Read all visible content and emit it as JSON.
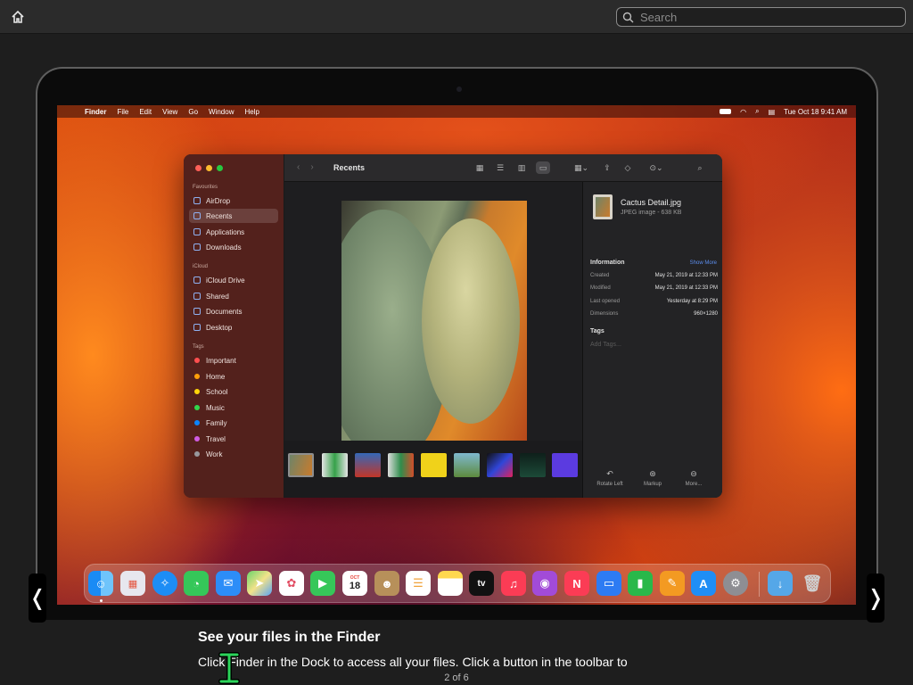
{
  "search": {
    "placeholder": "Search"
  },
  "menubar": {
    "app": "Finder",
    "items": [
      "File",
      "Edit",
      "View",
      "Go",
      "Window",
      "Help"
    ],
    "datetime": "Tue Oct 18  9:41 AM"
  },
  "finder": {
    "title": "Recents",
    "sidebar": {
      "favourites_label": "Favourites",
      "favourites": [
        "AirDrop",
        "Recents",
        "Applications",
        "Downloads"
      ],
      "icloud_label": "iCloud",
      "icloud": [
        "iCloud Drive",
        "Shared",
        "Documents",
        "Desktop"
      ],
      "tags_label": "Tags",
      "tags": [
        {
          "name": "Important",
          "color": "#ff4f4f"
        },
        {
          "name": "Home",
          "color": "#ff9f0a"
        },
        {
          "name": "School",
          "color": "#ffd60a"
        },
        {
          "name": "Music",
          "color": "#32d74b"
        },
        {
          "name": "Family",
          "color": "#0a84ff"
        },
        {
          "name": "Travel",
          "color": "#d05ce3"
        },
        {
          "name": "Work",
          "color": "#98989d"
        }
      ]
    },
    "info": {
      "file_name": "Cactus Detail.jpg",
      "file_kind": "JPEG image - 638 KB",
      "info_label": "Information",
      "show_more": "Show More",
      "rows": [
        {
          "k": "Created",
          "v": "May 21, 2019 at 12:33 PM"
        },
        {
          "k": "Modified",
          "v": "May 21, 2019 at 12:33 PM"
        },
        {
          "k": "Last opened",
          "v": "Yesterday at 8:29 PM"
        },
        {
          "k": "Dimensions",
          "v": "960×1280"
        }
      ],
      "tags_label": "Tags",
      "add_tags": "Add Tags...",
      "actions": [
        "Rotate Left",
        "Markup",
        "More..."
      ]
    }
  },
  "dock": {
    "calendar_month": "OCT",
    "calendar_day": "18",
    "tv_label": "tv"
  },
  "caption": {
    "title": "See your files in the Finder",
    "body": "Click Finder  in the Dock to access all your files. Click a button in the toolbar to",
    "page": "2 of 6"
  },
  "nav": {
    "prev": "❬",
    "next": "❭"
  }
}
